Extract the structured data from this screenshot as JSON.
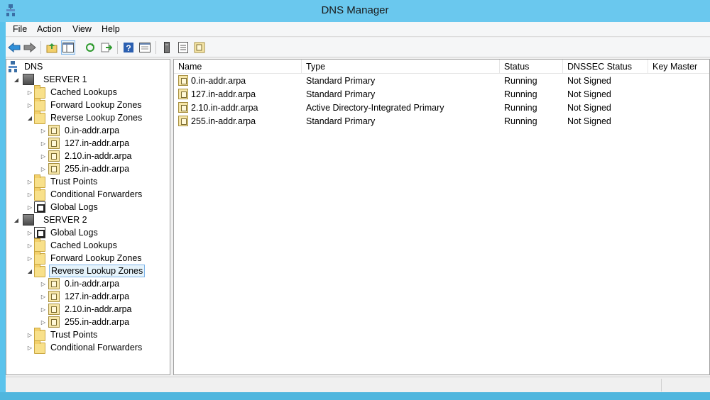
{
  "window": {
    "title": "DNS Manager"
  },
  "menu": {
    "items": [
      "File",
      "Action",
      "View",
      "Help"
    ]
  },
  "toolbar": {
    "buttons": [
      "back-icon",
      "forward-icon",
      "up-folder-icon",
      "show-hide-console-tree-icon",
      "refresh-icon",
      "export-list-icon",
      "help-icon",
      "properties-view-icon",
      "server-icon",
      "list-icon",
      "zone-icon"
    ]
  },
  "tree": {
    "root": "DNS",
    "server1": {
      "label": "SERVER 1",
      "children": [
        "Cached Lookups",
        "Forward Lookup Zones",
        "Reverse Lookup Zones"
      ],
      "reverse_zones": [
        "0.in-addr.arpa",
        "127.in-addr.arpa",
        "2.10.in-addr.arpa",
        "255.in-addr.arpa"
      ],
      "after": [
        "Trust Points",
        "Conditional Forwarders",
        "Global Logs"
      ]
    },
    "server2": {
      "label": "SERVER 2",
      "children": [
        "Global Logs",
        "Cached Lookups",
        "Forward Lookup Zones",
        "Reverse Lookup Zones"
      ],
      "reverse_zones": [
        "0.in-addr.arpa",
        "127.in-addr.arpa",
        "2.10.in-addr.arpa",
        "255.in-addr.arpa"
      ],
      "after": [
        "Trust Points",
        "Conditional Forwarders"
      ]
    }
  },
  "list": {
    "columns": [
      "Name",
      "Type",
      "Status",
      "DNSSEC Status",
      "Key Master"
    ],
    "rows": [
      {
        "name": "0.in-addr.arpa",
        "type": "Standard Primary",
        "status": "Running",
        "dnssec": "Not Signed",
        "key_master": ""
      },
      {
        "name": "127.in-addr.arpa",
        "type": "Standard Primary",
        "status": "Running",
        "dnssec": "Not Signed",
        "key_master": ""
      },
      {
        "name": "2.10.in-addr.arpa",
        "type": "Active Directory-Integrated Primary",
        "status": "Running",
        "dnssec": "Not Signed",
        "key_master": ""
      },
      {
        "name": "255.in-addr.arpa",
        "type": "Standard Primary",
        "status": "Running",
        "dnssec": "Not Signed",
        "key_master": ""
      }
    ]
  },
  "colors": {
    "titlebar": "#6ac8ee",
    "selection_border": "#7eb4ea",
    "selection_fill": "#e5f3fb"
  }
}
